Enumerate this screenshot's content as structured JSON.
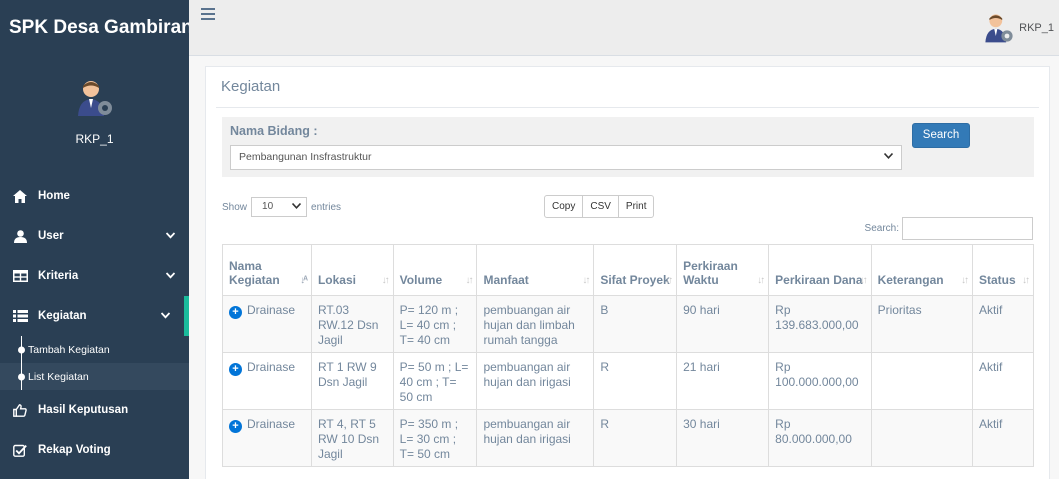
{
  "sidebar": {
    "brand": "SPK Desa Gambiran",
    "profile_name": "RKP_1",
    "menu": [
      {
        "label": "Home",
        "icon": "home-icon",
        "has_sub": false
      },
      {
        "label": "User",
        "icon": "user-icon",
        "has_sub": true
      },
      {
        "label": "Kriteria",
        "icon": "table-icon",
        "has_sub": true
      },
      {
        "label": "Kegiatan",
        "icon": "list-icon",
        "has_sub": true
      },
      {
        "label": "Hasil Keputusan",
        "icon": "thumbs-up-icon",
        "has_sub": false
      },
      {
        "label": "Rekap Voting",
        "icon": "check-square-icon",
        "has_sub": false
      }
    ],
    "submenu": [
      {
        "label": "Tambah Kegiatan"
      },
      {
        "label": "List Kegiatan"
      }
    ]
  },
  "topnav": {
    "username": "RKP_1"
  },
  "panel": {
    "title": "Kegiatan",
    "filter_label": "Nama Bidang :",
    "filter_value": "Pembangunan Insfrastruktur",
    "search_button": "Search"
  },
  "datatable": {
    "show_label": "Show",
    "entries_value": "10",
    "entries_label": "entries",
    "buttons": [
      "Copy",
      "CSV",
      "Print"
    ],
    "search_label": "Search:",
    "columns": [
      "Nama Kegiatan",
      "Lokasi",
      "Volume",
      "Manfaat",
      "Sifat Proyek",
      "Perkiraan Waktu",
      "Perkiraan Dana",
      "Keterangan",
      "Status"
    ],
    "rows": [
      {
        "nama": "Drainase",
        "lokasi": "RT.03 RW.12 Dsn Jagil",
        "volume": "P= 120 m ; L= 40 cm ; T= 40 cm",
        "manfaat": "pembuangan air hujan dan limbah rumah tangga",
        "sifat": "B",
        "waktu": "90 hari",
        "dana": "Rp 139.683.000,00",
        "keterangan": "Prioritas",
        "status": "Aktif"
      },
      {
        "nama": "Drainase",
        "lokasi": "RT 1 RW 9 Dsn Jagil",
        "volume": "P= 50 m ; L= 40 cm ; T= 50 cm",
        "manfaat": "pembuangan air hujan dan irigasi",
        "sifat": "R",
        "waktu": "21 hari",
        "dana": "Rp 100.000.000,00",
        "keterangan": "",
        "status": "Aktif"
      },
      {
        "nama": "Drainase",
        "lokasi": "RT 4, RT 5 RW 10 Dsn Jagil",
        "volume": "P= 350 m ; L= 30 cm ; T= 50 cm",
        "manfaat": "pembuangan air hujan dan irigasi",
        "sifat": "R",
        "waktu": "30 hari",
        "dana": "Rp 80.000.000,00",
        "keterangan": "",
        "status": "Aktif"
      }
    ]
  },
  "colors": {
    "sidebar_bg": "#2a3f54",
    "active_accent": "#1abb9c",
    "primary_button": "#337ab7",
    "expand_icon": "#0275d8"
  }
}
